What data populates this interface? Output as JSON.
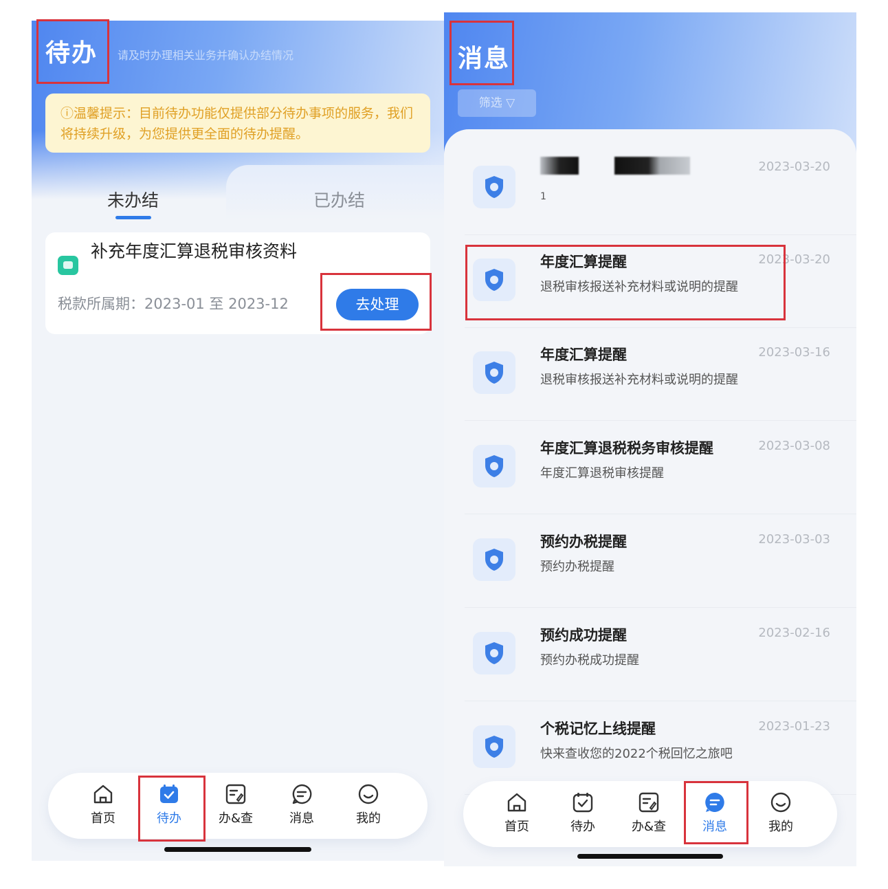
{
  "left": {
    "title": "待办",
    "subtitle": "请及时办理相关业务并确认办结情况",
    "tip": "ⓘ温馨提示：目前待办功能仅提供部分待办事项的服务，我们将持续升级，为您提供更全面的待办提醒。",
    "tabs": {
      "pending": "未办结",
      "done": "已办结"
    },
    "task": {
      "title": "补充年度汇算退税审核资料",
      "period": "税款所属期：2023-01 至 2023-12",
      "action": "去处理"
    },
    "nav": {
      "home": "首页",
      "todo": "待办",
      "query": "办&查",
      "messages": "消息",
      "mine": "我的"
    }
  },
  "right": {
    "title": "消息",
    "filter": "筛选 ▽",
    "messages": [
      {
        "title": "",
        "subtitle": "1",
        "date": "2023-03-20"
      },
      {
        "title": "年度汇算提醒",
        "subtitle": "退税审核报送补充材料或说明的提醒",
        "date": "2023-03-20"
      },
      {
        "title": "年度汇算提醒",
        "subtitle": "退税审核报送补充材料或说明的提醒",
        "date": "2023-03-16"
      },
      {
        "title": "年度汇算退税税务审核提醒",
        "subtitle": "年度汇算退税审核提醒",
        "date": "2023-03-08"
      },
      {
        "title": "预约办税提醒",
        "subtitle": "预约办税提醒",
        "date": "2023-03-03"
      },
      {
        "title": "预约成功提醒",
        "subtitle": "预约办税成功提醒",
        "date": "2023-02-16"
      },
      {
        "title": "个税记忆上线提醒",
        "subtitle": "快来查收您的2022个税回忆之旅吧",
        "date": "2023-01-23"
      }
    ],
    "nav": {
      "home": "首页",
      "todo": "待办",
      "query": "办&查",
      "messages": "消息",
      "mine": "我的"
    }
  },
  "colors": {
    "accent": "#2f7be8",
    "highlight_border": "#d8333c",
    "tip_bg": "#fdf5d2",
    "tip_text": "#e0a025"
  },
  "icons": [
    "home-icon",
    "todo-icon",
    "query-icon",
    "message-icon",
    "smile-icon",
    "shield-tax-icon",
    "filter-icon"
  ]
}
